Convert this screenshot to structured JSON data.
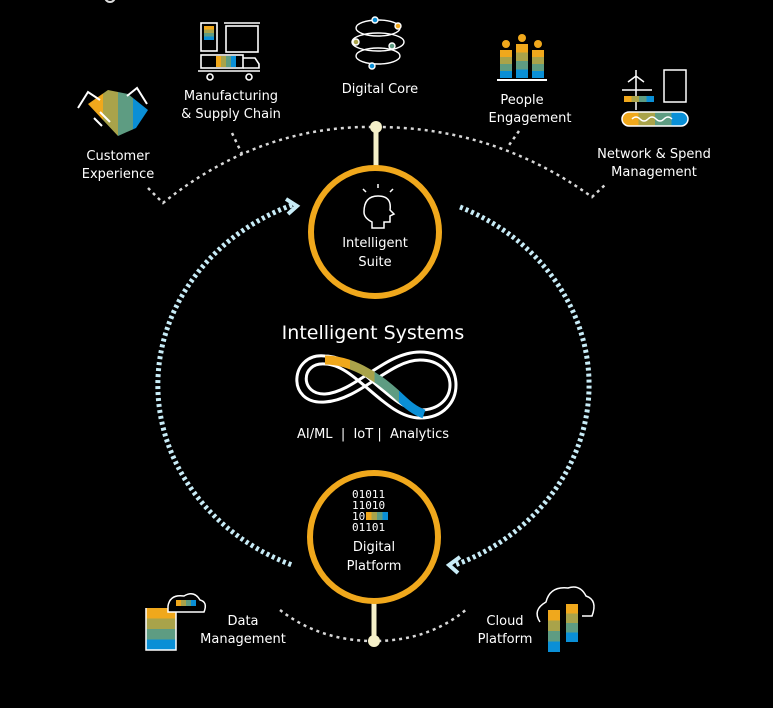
{
  "colors": {
    "accent": "#f0a81c",
    "flow": "#c8ecf7",
    "dotted": "#d8d8d8",
    "bg": "#000000",
    "stripe": [
      "#f0a81c",
      "#a9a34a",
      "#5e9c82",
      "#0a8fd6"
    ]
  },
  "center": {
    "title": "Intelligent Systems",
    "subtitle": "AI/ML  |  IoT |  Analytics",
    "icon": "infinity-icon"
  },
  "hubs": [
    {
      "line1": "Intelligent",
      "line2": "Suite",
      "icon": "lightbulb-head-icon"
    },
    {
      "line1": "Digital",
      "line2": "Platform",
      "icon": "binary-data-icon",
      "binary": [
        "01011",
        "11010",
        "10",
        "01101"
      ]
    }
  ],
  "top_nodes": [
    {
      "line1": "Customer",
      "line2": "Experience",
      "icon": "handshake-icon"
    },
    {
      "line1": "Manufacturing",
      "line2": "& Supply Chain",
      "icon": "factory-truck-icon"
    },
    {
      "line1": "Digital Core",
      "line2": "",
      "icon": "globe-network-icon"
    },
    {
      "line1": "People",
      "line2": "Engagement",
      "icon": "people-icon"
    },
    {
      "line1": "Network & Spend",
      "line2": "Management",
      "icon": "plane-calculator-icon"
    }
  ],
  "bottom_nodes": [
    {
      "line1": "Data",
      "line2": "Management",
      "icon": "document-cloud-icon"
    },
    {
      "line1": "Cloud",
      "line2": "Platform",
      "icon": "cloud-bars-icon"
    }
  ]
}
